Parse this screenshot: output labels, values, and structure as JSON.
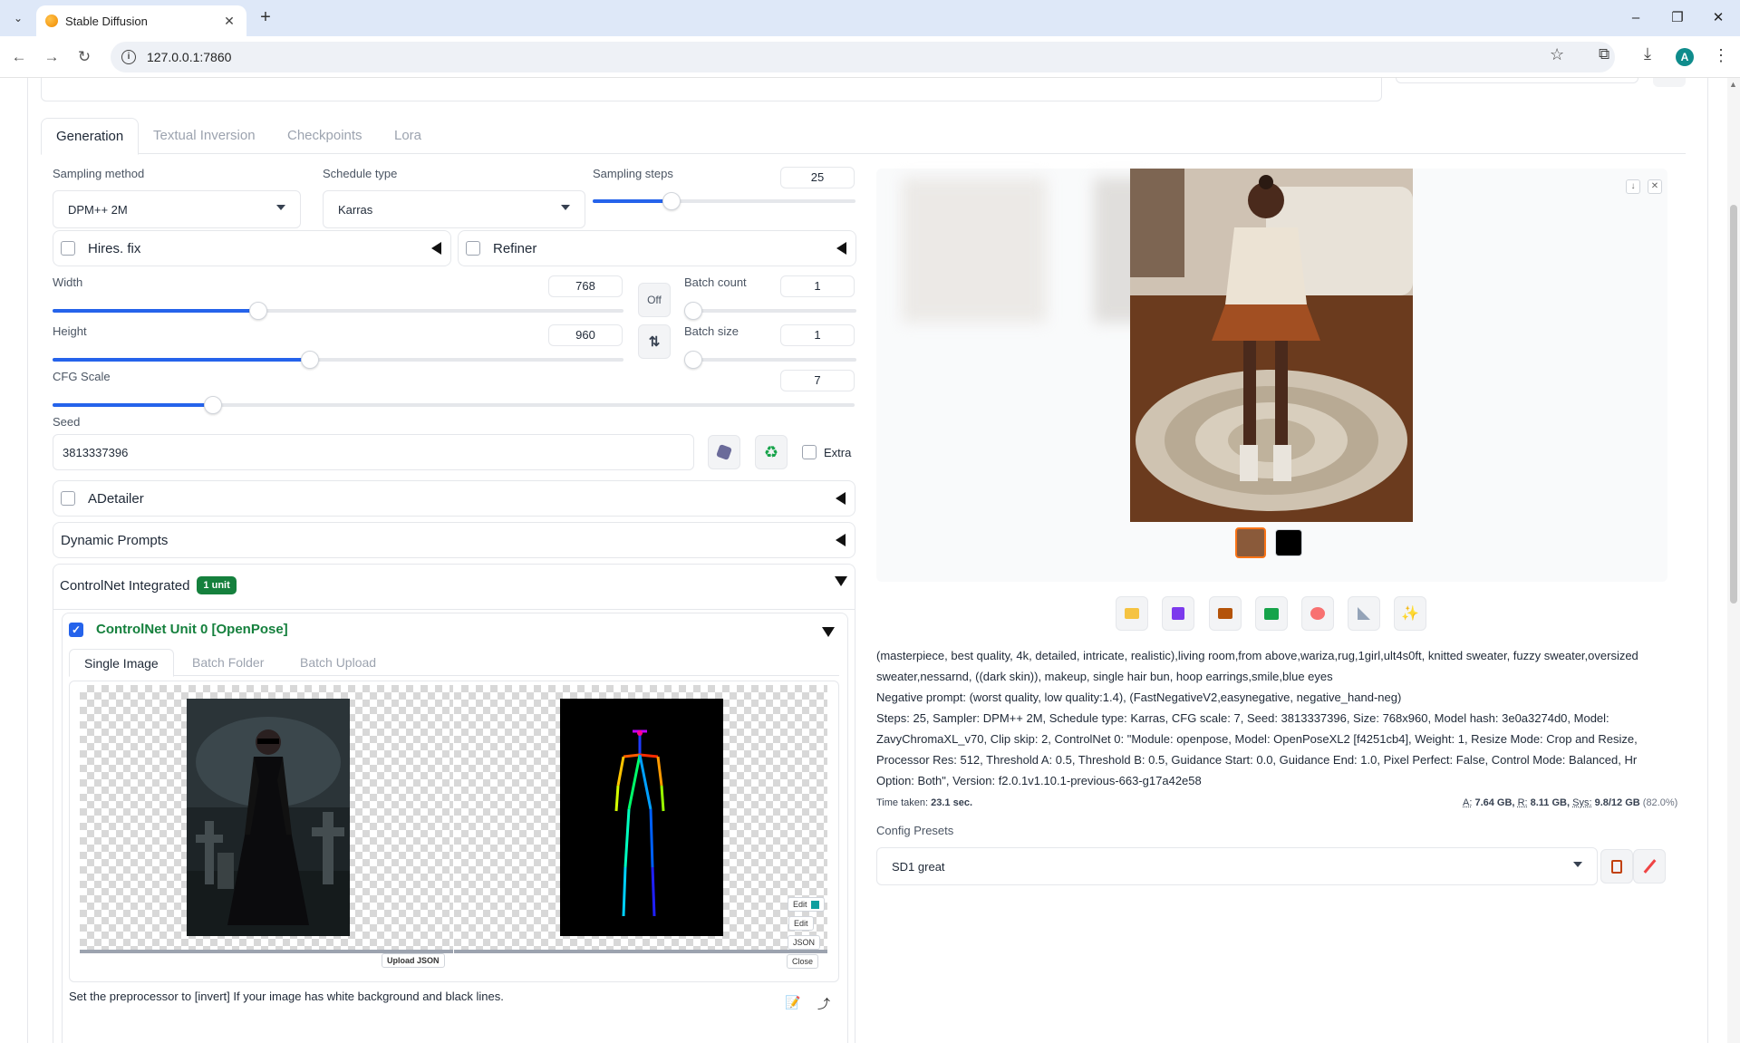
{
  "browser": {
    "tab_title": "Stable Diffusion",
    "url": "127.0.0.1:7860"
  },
  "tabs": [
    "Generation",
    "Textual Inversion",
    "Checkpoints",
    "Lora"
  ],
  "generation": {
    "sampling_method_label": "Sampling method",
    "sampling_method_value": "DPM++ 2M",
    "schedule_type_label": "Schedule type",
    "schedule_type_value": "Karras",
    "sampling_steps_label": "Sampling steps",
    "sampling_steps_value": "25",
    "hires_fix_label": "Hires. fix",
    "refiner_label": "Refiner",
    "width_label": "Width",
    "width_value": "768",
    "height_label": "Height",
    "height_value": "960",
    "off_label": "Off",
    "swap_icon": "swap-vertical-icon",
    "batch_count_label": "Batch count",
    "batch_count_value": "1",
    "batch_size_label": "Batch size",
    "batch_size_value": "1",
    "cfg_scale_label": "CFG Scale",
    "cfg_scale_value": "7",
    "seed_label": "Seed",
    "seed_value": "3813337396",
    "extra_label": "Extra",
    "sliders": {
      "sampling_steps": 0.3,
      "width": 0.36,
      "height": 0.45,
      "cfg": 0.2,
      "batch_count": 0.0,
      "batch_size": 0.0
    }
  },
  "accordions": {
    "adetailer": "ADetailer",
    "dynamic_prompts": "Dynamic Prompts",
    "controlnet": "ControlNet Integrated",
    "controlnet_badge": "1 unit"
  },
  "controlnet_unit": {
    "title": "ControlNet Unit 0 [OpenPose]",
    "tabs": [
      "Single Image",
      "Batch Folder",
      "Batch Upload"
    ],
    "upload_json": "Upload JSON",
    "edit_btns": [
      "Edit",
      "Edit",
      "JSON",
      "Close"
    ],
    "hint": "Set the preprocessor to [invert] If your image has white background and black lines."
  },
  "output": {
    "info_prompt": "(masterpiece, best quality, 4k, detailed, intricate, realistic),living room,from above,wariza,rug,1girl,ult4s0ft, knitted sweater, fuzzy sweater,oversized sweater,nessarnd, ((dark skin)), makeup, single hair bun, hoop earrings,smile,blue eyes",
    "info_negative": "Negative prompt: (worst quality, low quality:1.4), (FastNegativeV2,easynegative, negative_hand-neg)",
    "info_params": "Steps: 25, Sampler: DPM++ 2M, Schedule type: Karras, CFG scale: 7, Seed: 3813337396, Size: 768x960, Model hash: 3e0a3274d0, Model: ZavyChromaXL_v70, Clip skip: 2, ControlNet 0: \"Module: openpose, Model: OpenPoseXL2 [f4251cb4], Weight: 1, Resize Mode: Crop and Resize, Processor Res: 512, Threshold A: 0.5, Threshold B: 0.5, Guidance Start: 0.0, Guidance End: 1.0, Pixel Perfect: False, Control Mode: Balanced, Hr Option: Both\", Version: f2.0.1v1.10.1-previous-663-g17a42e58",
    "time_label": "Time taken:",
    "time_value": "23.1 sec.",
    "vram_a_label": "A:",
    "vram_a_value": "7.64 GB,",
    "vram_r_label": "R:",
    "vram_r_value": "8.11 GB,",
    "vram_sys_label": "Sys:",
    "vram_sys_value": "9.8/12 GB",
    "vram_pct": "(82.0%)",
    "config_presets_label": "Config Presets",
    "config_presets_value": "SD1 great"
  },
  "colors": {
    "accent": "#2563eb",
    "badge": "#15803d",
    "controlnet_title": "#15803d"
  }
}
